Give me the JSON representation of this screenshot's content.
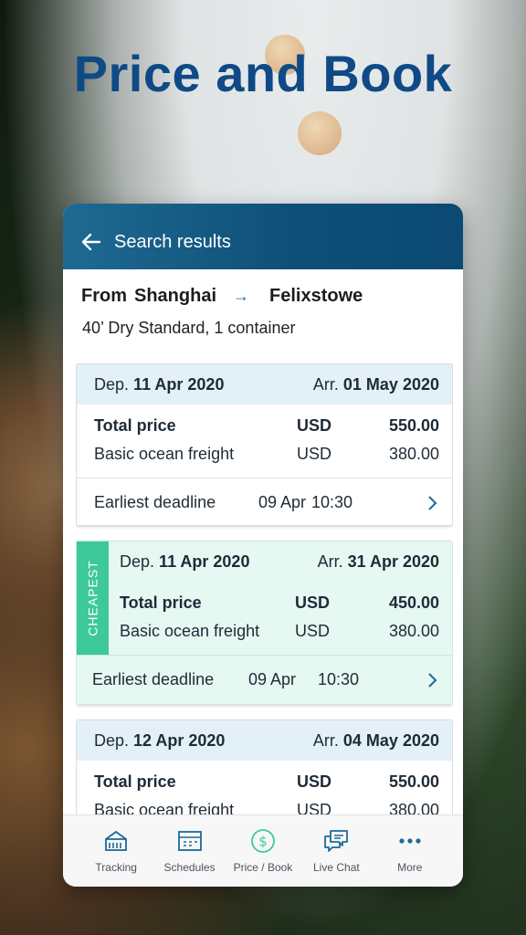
{
  "headline": "Price and Book",
  "appbar": {
    "title": "Search results",
    "back_icon": "arrow-left-icon"
  },
  "route": {
    "from_label": "From",
    "origin": "Shanghai",
    "destination": "Felixstowe"
  },
  "cargo": "40’ Dry Standard, 1 container",
  "results": [
    {
      "dep_label": "Dep.",
      "dep_date": "11 Apr 2020",
      "arr_label": "Arr.",
      "arr_date": "01 May 2020",
      "total_label": "Total price",
      "total_currency": "USD",
      "total_amount": "550.00",
      "freight_label": "Basic ocean freight",
      "freight_currency": "USD",
      "freight_amount": "380.00",
      "deadline_label": "Earliest deadline",
      "deadline_date": "09 Apr",
      "deadline_time": "10:30"
    },
    {
      "badge": "CHEAPEST",
      "dep_label": "Dep.",
      "dep_date": "11 Apr 2020",
      "arr_label": "Arr.",
      "arr_date": "31 Apr 2020",
      "total_label": "Total price",
      "total_currency": "USD",
      "total_amount": "450.00",
      "freight_label": "Basic ocean freight",
      "freight_currency": "USD",
      "freight_amount": "380.00",
      "deadline_label": "Earliest deadline",
      "deadline_date": "09 Apr",
      "deadline_time": "10:30"
    },
    {
      "dep_label": "Dep.",
      "dep_date": "12 Apr 2020",
      "arr_label": "Arr.",
      "arr_date": "04 May 2020",
      "total_label": "Total price",
      "total_currency": "USD",
      "total_amount": "550.00",
      "freight_label": "Basic ocean freight",
      "freight_currency": "USD",
      "freight_amount": "380.00"
    }
  ],
  "tabs": [
    {
      "label": "Tracking",
      "icon": "tracking-icon"
    },
    {
      "label": "Schedules",
      "icon": "schedules-icon"
    },
    {
      "label": "Price / Book",
      "icon": "dollar-icon"
    },
    {
      "label": "Live Chat",
      "icon": "chat-icon"
    },
    {
      "label": "More",
      "icon": "more-icon"
    }
  ],
  "colors": {
    "headline": "#0f4a86",
    "appbar": "#0e4e78",
    "accent": "#1d6a98",
    "cheapest_band": "#3dc99a",
    "cheapest_bg": "#e5f8f2",
    "dep_row_bg": "#e3f0f7"
  }
}
